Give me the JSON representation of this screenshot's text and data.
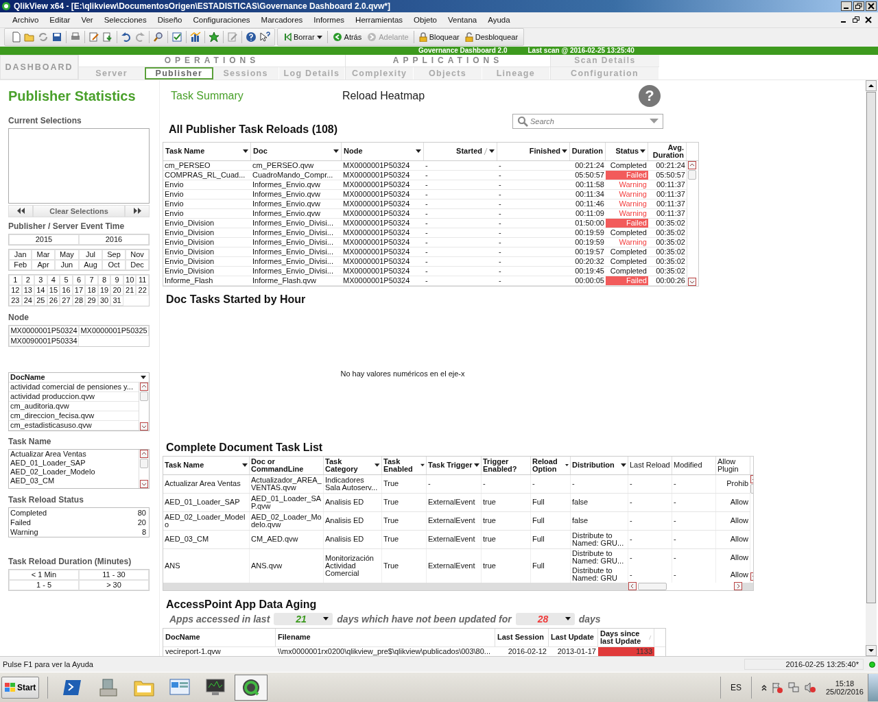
{
  "window": {
    "title": "QlikView x64 - [E:\\qlikview\\DocumentosOrigen\\ESTADISTICAS\\Governance Dashboard 2.0.qvw*]"
  },
  "menu": [
    "Archivo",
    "Editar",
    "Ver",
    "Selecciones",
    "Diseño",
    "Configuraciones",
    "Marcadores",
    "Informes",
    "Herramientas",
    "Objeto",
    "Ventana",
    "Ayuda"
  ],
  "toolbar_buttons": [
    {
      "label": "Borrar",
      "disabled": false
    },
    {
      "label": "Atrás",
      "disabled": false
    },
    {
      "label": "Adelante",
      "disabled": true
    },
    {
      "label": "Bloquear",
      "disabled": false
    },
    {
      "label": "Desbloquear",
      "disabled": false
    }
  ],
  "banner": {
    "title": "Governance Dashboard 2.0",
    "last_scan": "Last scan @ 2016-02-25 13:25:40"
  },
  "nav": {
    "home": "DASHBOARD",
    "groups": [
      {
        "title": "OPERATIONS",
        "tabs": [
          {
            "label": "Server",
            "selected": false
          },
          {
            "label": "Publisher",
            "selected": true
          },
          {
            "label": "Sessions",
            "selected": false
          },
          {
            "label": "Log Details",
            "selected": false
          }
        ]
      },
      {
        "title": "APPLICATIONS",
        "tabs": [
          {
            "label": "Complexity",
            "selected": false
          },
          {
            "label": "Objects",
            "selected": false
          },
          {
            "label": "Lineage",
            "selected": false
          }
        ]
      },
      {
        "title": "Scan Details",
        "tabs": [
          {
            "label": "Configuration",
            "selected": false
          }
        ]
      }
    ]
  },
  "sheet": {
    "title": "Publisher Statistics",
    "subtabs": [
      {
        "label": "Task Summary",
        "selected": true
      },
      {
        "label": "Reload Heatmap",
        "selected": false
      }
    ],
    "help": "?"
  },
  "sidebar": {
    "current_selections": {
      "title": "Current Selections",
      "clear": "Clear Selections"
    },
    "event_time": {
      "title": "Publisher / Server Event Time",
      "years": [
        "2015",
        "2016"
      ],
      "months": [
        "Jan",
        "Feb",
        "Mar",
        "Apr",
        "May",
        "Jun",
        "Jul",
        "Aug",
        "Sep",
        "Oct",
        "Nov",
        "Dec"
      ],
      "days": [
        "1",
        "2",
        "3",
        "4",
        "5",
        "6",
        "7",
        "8",
        "9",
        "10",
        "11",
        "12",
        "13",
        "14",
        "15",
        "16",
        "17",
        "18",
        "19",
        "20",
        "21",
        "22",
        "23",
        "24",
        "25",
        "26",
        "27",
        "28",
        "29",
        "30",
        "31"
      ]
    },
    "node": {
      "title": "Node",
      "values": [
        "MX0000001P50324",
        "MX0000001P50325",
        "MX0090001P50334"
      ]
    },
    "docname": {
      "header": "DocName",
      "items": [
        "actividad comercial de pensiones y...",
        "actividad produccion.qvw",
        "cm_auditoria.qvw",
        "cm_direccion_fecisa.qvw",
        "cm_estadisticasuso.qvw"
      ]
    },
    "task_name": {
      "title": "Task Name",
      "items": [
        "Actualizar Area Ventas",
        "AED_01_Loader_SAP",
        "AED_02_Loader_Modelo",
        "AED_03_CM"
      ]
    },
    "reload_status": {
      "title": "Task Reload Status",
      "rows": [
        {
          "label": "Completed",
          "count": "80"
        },
        {
          "label": "Failed",
          "count": "20"
        },
        {
          "label": "Warning",
          "count": "8"
        }
      ]
    },
    "duration": {
      "title": "Task Reload Duration (Minutes)",
      "values": [
        "< 1 Min",
        "11 - 30",
        "1 - 5",
        "> 30"
      ]
    }
  },
  "reloads": {
    "title": "All Publisher Task Reloads (108)",
    "search_placeholder": "Search",
    "columns": [
      {
        "label": "Task Name",
        "dropdown": true
      },
      {
        "label": "Doc",
        "dropdown": true
      },
      {
        "label": "Node",
        "dropdown": true
      },
      {
        "label": "Started",
        "dropdown": true
      },
      {
        "label": "Finished",
        "dropdown": true
      },
      {
        "label": "Duration",
        "dropdown": false
      },
      {
        "label": "Status",
        "dropdown": true
      },
      {
        "label": "Avg. Duration",
        "dropdown": false
      }
    ],
    "rows": [
      {
        "cells": [
          "cm_PERSEO",
          "cm_PERSEO.qvw",
          "MX0000001P50324",
          "-",
          "-",
          "00:21:24",
          "Completed",
          "00:21:24"
        ],
        "kind": "completed"
      },
      {
        "cells": [
          "COMPRAS_RL_Cuad...",
          "CuadroMando_Compr...",
          "MX0000001P50324",
          "-",
          "-",
          "05:50:57",
          "Failed",
          "05:50:57"
        ],
        "kind": "failed"
      },
      {
        "cells": [
          "Envio",
          "Informes_Envio.qvw",
          "MX0000001P50324",
          "-",
          "-",
          "00:11:58",
          "Warning",
          "00:11:37"
        ],
        "kind": "warning"
      },
      {
        "cells": [
          "Envio",
          "Informes_Envio.qvw",
          "MX0000001P50324",
          "-",
          "-",
          "00:11:34",
          "Warning",
          "00:11:37"
        ],
        "kind": "warning"
      },
      {
        "cells": [
          "Envio",
          "Informes_Envio.qvw",
          "MX0000001P50324",
          "-",
          "-",
          "00:11:46",
          "Warning",
          "00:11:37"
        ],
        "kind": "warning"
      },
      {
        "cells": [
          "Envio",
          "Informes_Envio.qvw",
          "MX0000001P50324",
          "-",
          "-",
          "00:11:09",
          "Warning",
          "00:11:37"
        ],
        "kind": "warning"
      },
      {
        "cells": [
          "Envio_Division",
          "Informes_Envio_Divisi...",
          "MX0000001P50324",
          "-",
          "-",
          "01:50:00",
          "Failed",
          "00:35:02"
        ],
        "kind": "failed"
      },
      {
        "cells": [
          "Envio_Division",
          "Informes_Envio_Divisi...",
          "MX0000001P50324",
          "-",
          "-",
          "00:19:59",
          "Completed",
          "00:35:02"
        ],
        "kind": "completed"
      },
      {
        "cells": [
          "Envio_Division",
          "Informes_Envio_Divisi...",
          "MX0000001P50324",
          "-",
          "-",
          "00:19:59",
          "Warning",
          "00:35:02"
        ],
        "kind": "warning"
      },
      {
        "cells": [
          "Envio_Division",
          "Informes_Envio_Divisi...",
          "MX0000001P50324",
          "-",
          "-",
          "00:19:57",
          "Completed",
          "00:35:02"
        ],
        "kind": "completed"
      },
      {
        "cells": [
          "Envio_Division",
          "Informes_Envio_Divisi...",
          "MX0000001P50324",
          "-",
          "-",
          "00:20:32",
          "Completed",
          "00:35:02"
        ],
        "kind": "completed"
      },
      {
        "cells": [
          "Envio_Division",
          "Informes_Envio_Divisi...",
          "MX0000001P50324",
          "-",
          "-",
          "00:19:45",
          "Completed",
          "00:35:02"
        ],
        "kind": "completed"
      },
      {
        "cells": [
          "Informe_Flash",
          "Informe_Flash.qvw",
          "MX0000001P50324",
          "-",
          "-",
          "00:00:05",
          "Failed",
          "00:00:26"
        ],
        "kind": "failed"
      }
    ]
  },
  "hour_chart": {
    "title": "Doc Tasks Started by Hour",
    "message": "No hay valores numéricos en el eje-x"
  },
  "task_list": {
    "title": "Complete Document Task List",
    "columns": [
      {
        "label": "Task Name",
        "dropdown": true
      },
      {
        "label": "Doc or CommandLine",
        "dropdown": false
      },
      {
        "label": "Task Category",
        "dropdown": true
      },
      {
        "label": "Task Enabled",
        "dropdown": true
      },
      {
        "label": "Task Trigger",
        "dropdown": true
      },
      {
        "label": "Trigger Enabled?",
        "dropdown": false
      },
      {
        "label": "Reload Option",
        "dropdown": true
      },
      {
        "label": "Distribution",
        "dropdown": true
      },
      {
        "label": "Last Reload",
        "dropdown": false
      },
      {
        "label": "Modified",
        "dropdown": false
      },
      {
        "label": "Allow Plugin",
        "dropdown": false
      }
    ],
    "rows": [
      [
        "Actualizar Area Ventas",
        "Actualizador_AREA_VENTAS.qvw",
        "Indicadores Sala Autoserv...",
        "True",
        "-",
        "-",
        "-",
        "-",
        "-",
        "-",
        "Prohib"
      ],
      [
        "AED_01_Loader_SAP",
        "AED_01_Loader_SAP.qvw",
        "Analisis ED",
        "True",
        "ExternalEvent",
        "true",
        "Full",
        "false",
        "-",
        "-",
        "Allow"
      ],
      [
        "AED_02_Loader_Modelo",
        "AED_02_Loader_Modelo.qvw",
        "Analisis ED",
        "True",
        "ExternalEvent",
        "true",
        "Full",
        "false",
        "-",
        "-",
        "Allow"
      ],
      [
        "AED_03_CM",
        "CM_AED.qvw",
        "Analisis ED",
        "True",
        "ExternalEvent",
        "true",
        "Full",
        "Distribute to Named: GRU...",
        "-",
        "-",
        "Allow"
      ],
      [
        "ANS",
        "ANS.qvw",
        "Monitorización Actividad Comercial",
        "True",
        "ExternalEvent",
        "true",
        "Full",
        [
          "Distribute to Named: GRU...",
          "Distribute to Named: GRU"
        ],
        [
          "-",
          "-"
        ],
        [
          "-",
          "-"
        ],
        [
          "Allow",
          "Allow"
        ]
      ]
    ]
  },
  "aging": {
    "title": "AccessPoint App Data Aging",
    "sentence": [
      {
        "kind": "text",
        "text": "Apps accessed in last"
      },
      {
        "kind": "dropdown",
        "value": "21",
        "color": "#3c9a1e"
      },
      {
        "kind": "text",
        "text": "days which have not been updated for"
      },
      {
        "kind": "dropdown",
        "value": "28",
        "color": "#f03c3c"
      },
      {
        "kind": "text",
        "text": "days"
      }
    ],
    "columns": [
      "DocName",
      "Filename",
      "Last Session",
      "Last Update",
      "Days since last Update"
    ],
    "rows": [
      [
        "vecireport-1.qvw",
        "\\\\mx0000001rx0200\\qlikview_pre$\\qlikview\\publicados\\003\\80...",
        "2016-02-12",
        "2013-01-17",
        "1133"
      ]
    ]
  },
  "status_bar": {
    "help": "Pulse F1 para ver la Ayuda",
    "timestamp": "2016-02-25 13:25:40*"
  },
  "taskbar": {
    "start": "Start",
    "apps": [
      {
        "selected": false
      },
      {
        "selected": false
      },
      {
        "selected": false
      },
      {
        "selected": false
      },
      {
        "selected": false
      },
      {
        "selected": true
      }
    ],
    "language": "ES",
    "time": "15:18",
    "date": "25/02/2016"
  }
}
